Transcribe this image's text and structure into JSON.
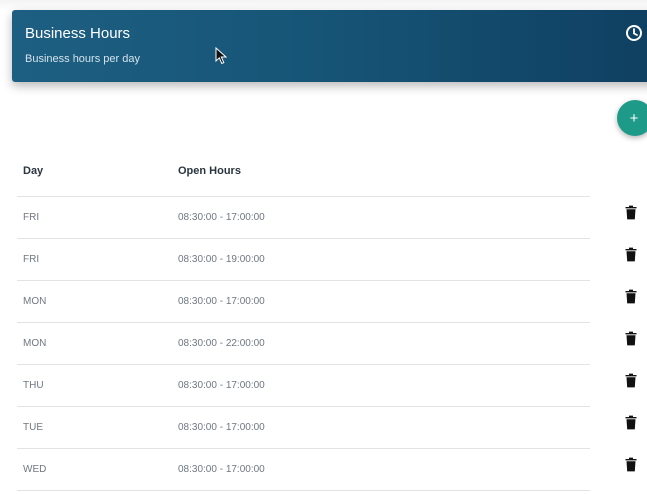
{
  "header": {
    "title": "Business Hours",
    "subtitle": "Business hours per day",
    "icon": "clock-icon"
  },
  "actions": {
    "add_label": "+",
    "delete_icon": "trash-icon"
  },
  "table": {
    "columns": {
      "day": "Day",
      "hours": "Open Hours"
    },
    "rows": [
      {
        "day": "FRI",
        "hours": "08:30:00 - 17:00:00"
      },
      {
        "day": "FRI",
        "hours": "08:30:00 - 19:00:00"
      },
      {
        "day": "MON",
        "hours": "08:30:00 - 17:00:00"
      },
      {
        "day": "MON",
        "hours": "08:30:00 - 22:00:00"
      },
      {
        "day": "THU",
        "hours": "08:30:00 - 17:00:00"
      },
      {
        "day": "TUE",
        "hours": "08:30:00 - 17:00:00"
      },
      {
        "day": "WED",
        "hours": "08:30:00 - 17:00:00"
      }
    ]
  },
  "colors": {
    "header_bg": "#175577",
    "accent": "#1e9a88"
  }
}
